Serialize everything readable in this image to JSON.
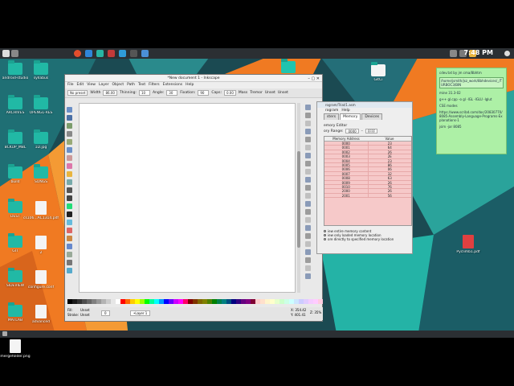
{
  "panel": {
    "clock": "7:48 PM",
    "icon_colors": [
      "#e34d2c",
      "#2f86d9",
      "#28b5a4",
      "#c43a3a",
      "#2f9bd8",
      "#555555",
      "#4b8fd6",
      "#e9b53f",
      "#888888",
      "#7a7a7a"
    ]
  },
  "desktop_icons": [
    {
      "label": "android-studio",
      "kind": "folder"
    },
    {
      "label": "syllabus",
      "kind": "folder"
    },
    {
      "label": "ARCHIVES",
      "kind": "folder"
    },
    {
      "label": "OPENGL-RES",
      "kind": "folder"
    },
    {
      "label": "BCKUP_MBL",
      "kind": "folder"
    },
    {
      "label": "1D.jpg",
      "kind": "folder"
    },
    {
      "label": "build",
      "kind": "folder"
    },
    {
      "label": "SONGS",
      "kind": "folder"
    },
    {
      "label": "DEST",
      "kind": "folder"
    },
    {
      "label": "cs106...AC1314.pdf",
      "kind": "file"
    },
    {
      "label": "GIT",
      "kind": "folder"
    },
    {
      "label": "2",
      "kind": "file"
    },
    {
      "label": "SIDEVIEW",
      "kind": "folder"
    },
    {
      "label": "configure.conf",
      "kind": "file"
    },
    {
      "label": "MATLAB",
      "kind": "folder"
    },
    {
      "label": "advanced",
      "kind": "file"
    },
    {
      "label": "mergefolder.png",
      "kind": "file"
    }
  ],
  "right_desktop_icons": [
    {
      "label": "GitCi"
    },
    {
      "label": "Pyclimb1.pdf"
    }
  ],
  "inkscape": {
    "title": "*New document 1 - Inkscape",
    "menu": [
      "File",
      "Edit",
      "View",
      "Layer",
      "Object",
      "Path",
      "Text",
      "Filters",
      "Extensions",
      "Help"
    ],
    "toolbar": {
      "preset": "No preset",
      "width_label": "Width",
      "width_val": "86.00",
      "thinning_label": "Thinning:",
      "thinning_val": "10",
      "angle_label": "Angle:",
      "angle_val": "30",
      "fixation_label": "Fixation:",
      "fixation_val": "90",
      "caps_label": "Caps:",
      "caps_val": "0.00",
      "mass_label": "Mass",
      "tremor_label": "Tremor",
      "unset1": "Unset",
      "unset2": "Unset"
    },
    "status": {
      "fill_label": "Fill:",
      "fill_val": "Unset",
      "stroke_label": "Stroke:",
      "stroke_val": "Unset",
      "opacity": "0",
      "layer": "•Layer 1",
      "x": "X: 354.42",
      "y": "Y: 401.41",
      "z": "Z: 35%"
    },
    "palette": [
      "#000000",
      "#1a1a1a",
      "#333333",
      "#4d4d4d",
      "#666666",
      "#808080",
      "#999999",
      "#b3b3b3",
      "#cccccc",
      "#e6e6e6",
      "#ffffff",
      "#ff0000",
      "#ff6600",
      "#ffcc00",
      "#ffff00",
      "#99ff00",
      "#00ff00",
      "#00ff99",
      "#00ffff",
      "#0099ff",
      "#0000ff",
      "#6600ff",
      "#cc00ff",
      "#ff00ff",
      "#ff0066",
      "#800000",
      "#803300",
      "#806600",
      "#808000",
      "#4d8000",
      "#008000",
      "#00804d",
      "#008080",
      "#004d80",
      "#000080",
      "#330080",
      "#660080",
      "#800080",
      "#800033",
      "#ffcccc",
      "#ffe0cc",
      "#fff5cc",
      "#ffffcc",
      "#e6ffcc",
      "#ccffcc",
      "#ccffe6",
      "#ccffff",
      "#cce6ff",
      "#ccccff",
      "#e0ccff",
      "#f5ccff",
      "#ffccff",
      "#ffcce0"
    ]
  },
  "simulator": {
    "title": "rogram/Trial/1.asm",
    "menu": [
      "rogram",
      "Help"
    ],
    "tabs": [
      "sters",
      "Memory",
      "Devices"
    ],
    "active_tab": 1,
    "editor_title": "emory Editor",
    "range_label": "ory Range:",
    "range_from": "0000",
    "range_to": "FFFF",
    "columns": [
      "Memory Address",
      "Value"
    ],
    "rows": [
      [
        "0000",
        "23"
      ],
      [
        "0001",
        "64"
      ],
      [
        "0002",
        "26"
      ],
      [
        "0003",
        "2E"
      ],
      [
        "0004",
        "23"
      ],
      [
        "0005",
        "86"
      ],
      [
        "0006",
        "06"
      ],
      [
        "0007",
        "32"
      ],
      [
        "0008",
        "63"
      ],
      [
        "0009",
        "26"
      ],
      [
        "0010",
        "76"
      ],
      [
        "2000",
        "26"
      ],
      [
        "2001",
        "56"
      ]
    ],
    "options": [
      "iew entire memory content",
      "iew only loaded memory location",
      "ore directly to specified memory location"
    ]
  },
  "notes": {
    "line1": "cdev.txt by jm cma/8bhtm",
    "path": "/home/jsmith/jsz_work/8bhdevices/_/TURBOC3/BIN",
    "line3": "mine 31.3-02",
    "line4": "g++ gl.cpp -o gl -lGL -lGLU -lglut",
    "line5": "CSE modes",
    "line6": "https://www.scribd.com/doc/20830770/8085-Assembly-Language-Programs-Explanations-1",
    "line7": "jsim -jar 8085"
  }
}
